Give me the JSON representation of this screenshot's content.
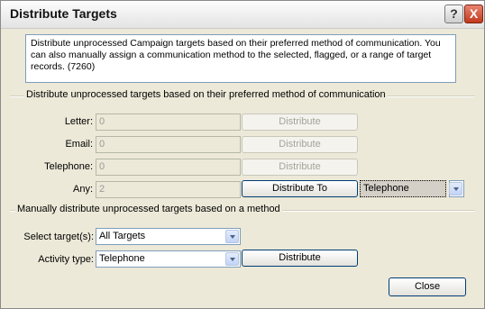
{
  "window": {
    "title": "Distribute Targets",
    "help_button": "?",
    "close_button": "X"
  },
  "description": "Distribute unprocessed Campaign targets based on their preferred method of communication. You can also manually assign a communication method to the selected, flagged, or a range of target records. (7260)",
  "group1": {
    "label": "Distribute unprocessed targets based on their preferred method of communication",
    "rows": {
      "letter": {
        "label": "Letter:",
        "value": "0",
        "button": "Distribute"
      },
      "email": {
        "label": "Email:",
        "value": "0",
        "button": "Distribute"
      },
      "telephone": {
        "label": "Telephone:",
        "value": "0",
        "button": "Distribute"
      },
      "any": {
        "label": "Any:",
        "value": "2",
        "button": "Distribute To",
        "method": "Telephone"
      }
    }
  },
  "group2": {
    "label": "Manually distribute unprocessed targets based on a method",
    "select_targets": {
      "label": "Select target(s):",
      "value": "All Targets"
    },
    "activity_type": {
      "label": "Activity type:",
      "value": "Telephone",
      "button": "Distribute"
    }
  },
  "footer": {
    "close": "Close"
  },
  "colors": {
    "window_bg": "#ece9d8",
    "focus_border": "#003c74",
    "input_border": "#7f9db9"
  }
}
